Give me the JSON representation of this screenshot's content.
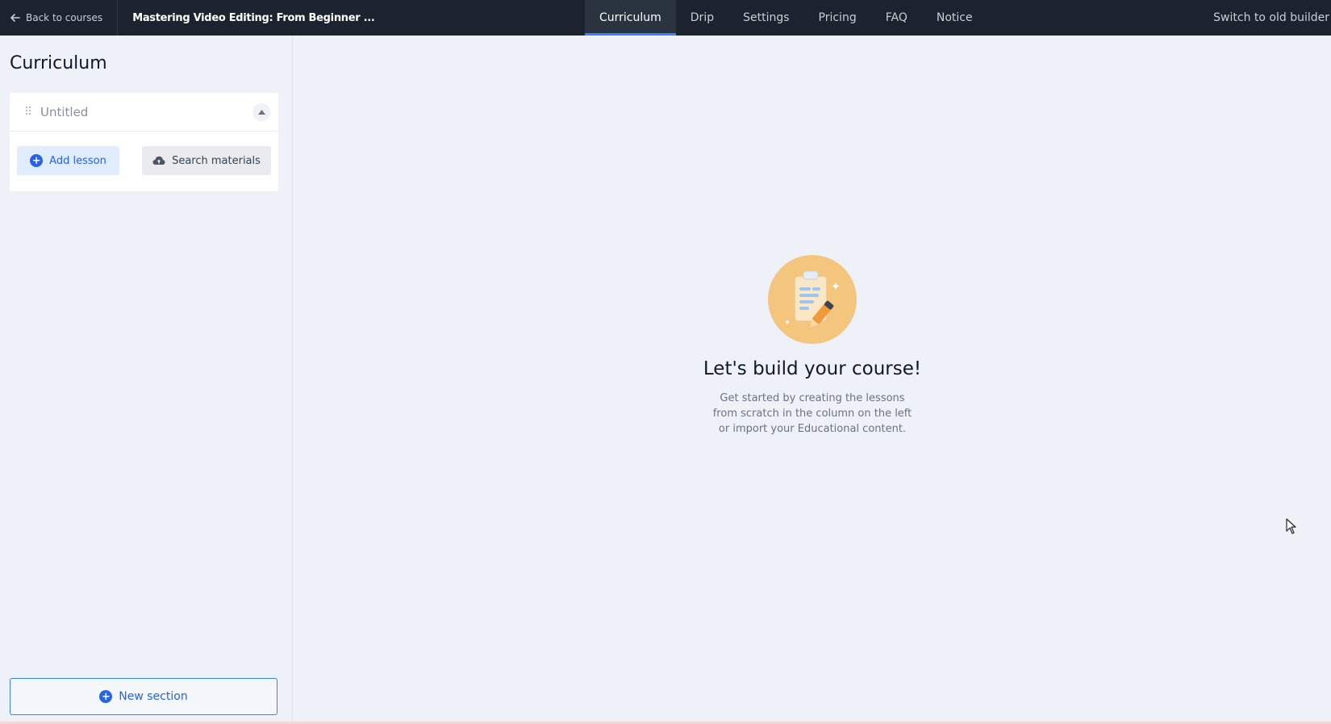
{
  "topbar": {
    "back_label": "Back to courses",
    "course_title": "Mastering Video Editing: From Beginner ...",
    "tabs": [
      {
        "label": "Curriculum",
        "active": true
      },
      {
        "label": "Drip",
        "active": false
      },
      {
        "label": "Settings",
        "active": false
      },
      {
        "label": "Pricing",
        "active": false
      },
      {
        "label": "FAQ",
        "active": false
      },
      {
        "label": "Notice",
        "active": false
      }
    ],
    "switch_label": "Switch to old builder"
  },
  "sidebar": {
    "title": "Curriculum",
    "section": {
      "name": "Untitled",
      "add_lesson_label": "Add lesson",
      "search_materials_label": "Search materials"
    },
    "new_section_label": "New section"
  },
  "main": {
    "empty_title": "Let's build your course!",
    "empty_desc": "Get started by creating the lessons from scratch in the column on the left or import your Educational content."
  },
  "colors": {
    "topbar_bg": "#1c232e",
    "accent": "#2563eb",
    "page_bg": "#eef1f7",
    "illustration_bg": "#f4c57c"
  },
  "icons": [
    "arrow-left-icon",
    "drag-handle-icon",
    "chevron-up-icon",
    "plus-circle-icon",
    "cloud-upload-icon",
    "clipboard-pencil-illustration",
    "mouse-cursor-icon"
  ]
}
